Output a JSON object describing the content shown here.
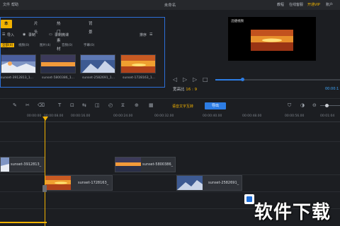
{
  "titlebar": {
    "menu": [
      "文件",
      "帮助"
    ],
    "document_title": "未命名",
    "right_items": [
      "教程",
      "在线客服",
      "开通VIP",
      "账户"
    ]
  },
  "media_panel": {
    "tabs": [
      "本地素材",
      "片头",
      "热门素材",
      "背景"
    ],
    "toolbar": {
      "import_label": "导入",
      "record_label": "录制",
      "record_voice_label": "录制微课",
      "sort_label": "排序"
    },
    "filters": [
      "全部(4)",
      "视频(0)",
      "图片(4)",
      "音频(0)",
      "字幕(0)"
    ],
    "items": [
      {
        "label": "sunset-3912813_1..."
      },
      {
        "label": "sunset-5800386_1..."
      },
      {
        "label": "sunset-2582691_1..."
      },
      {
        "label": "sunset-1728163_1..."
      }
    ]
  },
  "preview": {
    "overlay_text": "迅捷视频",
    "ratio_label": "宽高比",
    "ratio_value": "16 : 9",
    "timecode": "00:00:1"
  },
  "edit_toolbar": {
    "word_link": "语音文字互转",
    "export_label": "导出"
  },
  "ruler": {
    "marks": [
      "00:00:00",
      "00:00:08.00",
      "00:00:16.00",
      "00:00:24.00",
      "00:00:32.00",
      "00:00:40.00",
      "00:00:48.00",
      "00:00:56.00",
      "00:01:04"
    ]
  },
  "timeline": {
    "clips": [
      {
        "label": "sunset-3912813_"
      },
      {
        "label": "sunset-5800386_"
      },
      {
        "label": "sunset-1728163_"
      },
      {
        "label": "sunset-2582691_"
      }
    ]
  },
  "watermark": {
    "text": "软件下载"
  }
}
